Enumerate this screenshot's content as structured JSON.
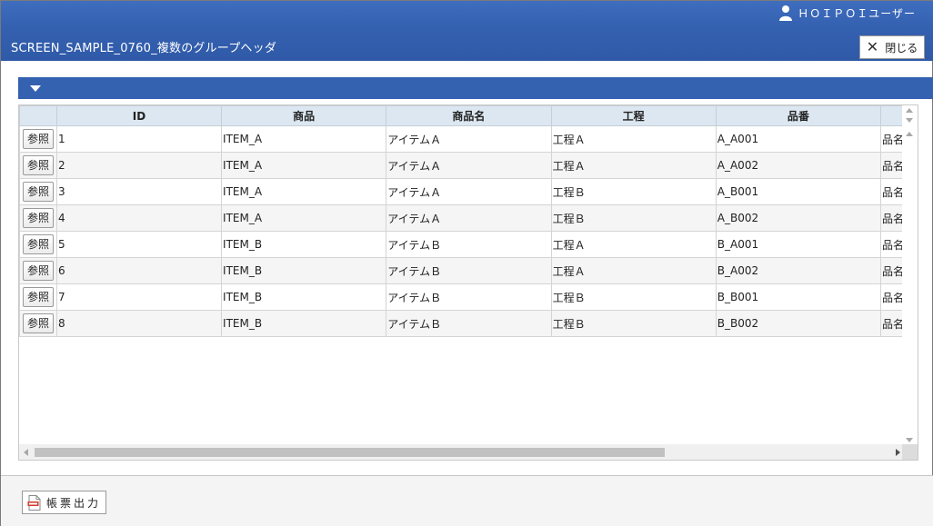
{
  "header": {
    "user_name": "ＨＯＩＰＯＩユーザー",
    "title": "SCREEN_SAMPLE_0760_複数のグループヘッダ",
    "close_label": "閉じる"
  },
  "grid": {
    "ref_button_label": "参照",
    "columns": [
      "",
      "ID",
      "商品",
      "商品名",
      "工程",
      "品番",
      ""
    ],
    "rows": [
      {
        "id": "1",
        "item": "ITEM_A",
        "item_name": "アイテムＡ",
        "process": "工程Ａ",
        "part_no": "A_A001",
        "part_name": "品名"
      },
      {
        "id": "2",
        "item": "ITEM_A",
        "item_name": "アイテムＡ",
        "process": "工程Ａ",
        "part_no": "A_A002",
        "part_name": "品名"
      },
      {
        "id": "3",
        "item": "ITEM_A",
        "item_name": "アイテムＡ",
        "process": "工程Ｂ",
        "part_no": "A_B001",
        "part_name": "品名"
      },
      {
        "id": "4",
        "item": "ITEM_A",
        "item_name": "アイテムＡ",
        "process": "工程Ｂ",
        "part_no": "A_B002",
        "part_name": "品名"
      },
      {
        "id": "5",
        "item": "ITEM_B",
        "item_name": "アイテムＢ",
        "process": "工程Ａ",
        "part_no": "B_A001",
        "part_name": "品名"
      },
      {
        "id": "6",
        "item": "ITEM_B",
        "item_name": "アイテムＢ",
        "process": "工程Ａ",
        "part_no": "B_A002",
        "part_name": "品名"
      },
      {
        "id": "7",
        "item": "ITEM_B",
        "item_name": "アイテムＢ",
        "process": "工程Ｂ",
        "part_no": "B_B001",
        "part_name": "品名"
      },
      {
        "id": "8",
        "item": "ITEM_B",
        "item_name": "アイテムＢ",
        "process": "工程Ｂ",
        "part_no": "B_B002",
        "part_name": "品名"
      }
    ]
  },
  "footer": {
    "report_label": "帳票出力"
  },
  "icons": {
    "user": "user-icon",
    "close": "close-icon",
    "collapse": "triangle-down-icon",
    "pdf": "pdf-icon"
  },
  "colors": {
    "title_bar": "#3561b1",
    "grid_header": "#dce7f1"
  }
}
